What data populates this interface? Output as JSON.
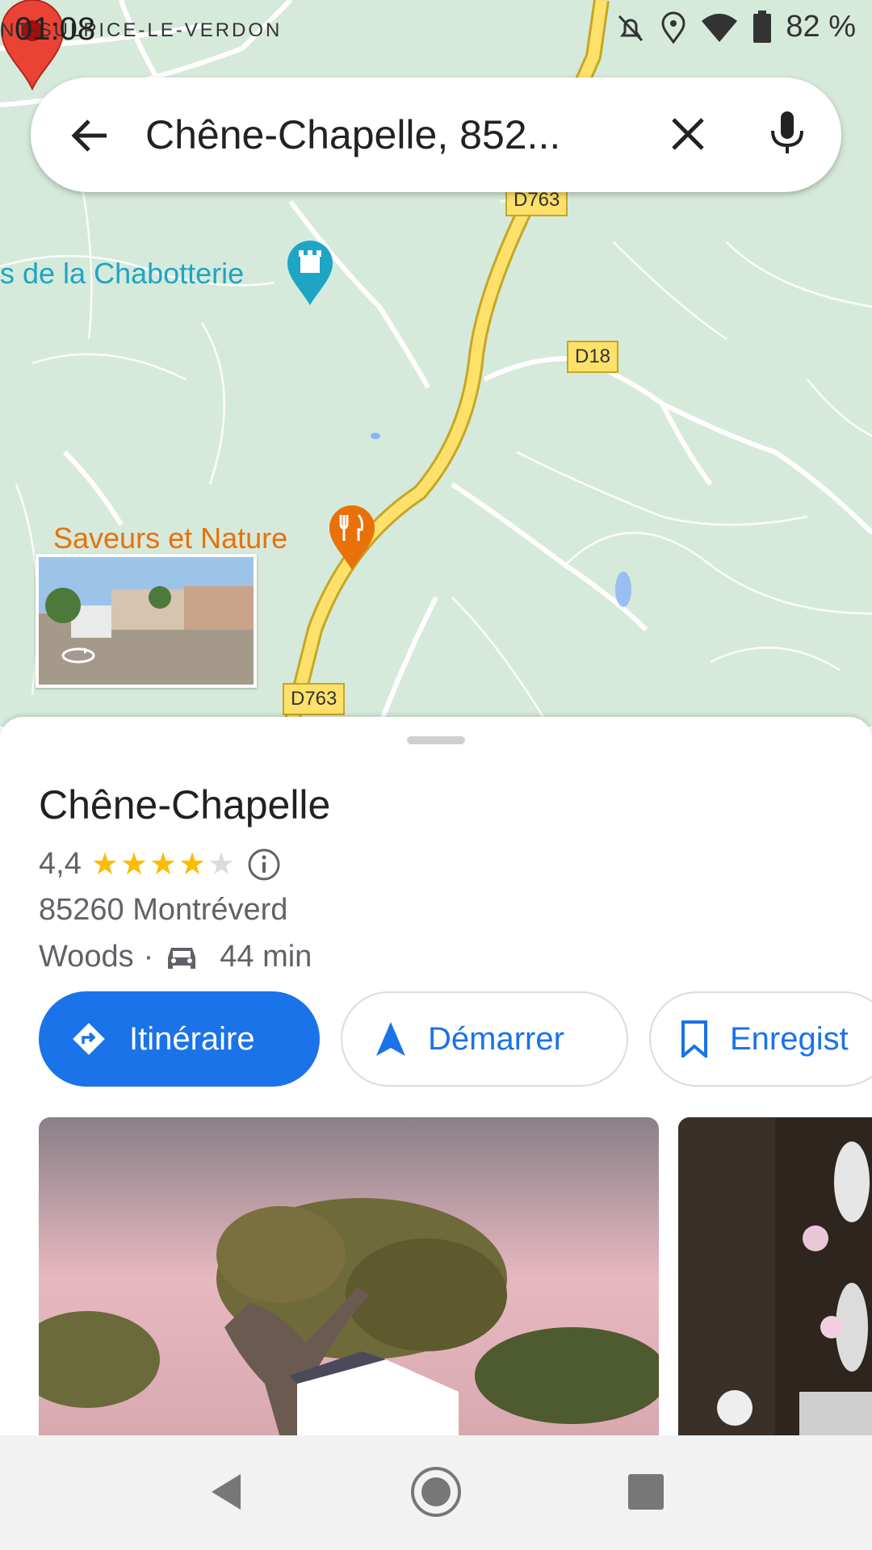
{
  "status_bar": {
    "time": "01:08",
    "battery": "82 %",
    "top_place": "NT-SULPICE-LE-VERDON"
  },
  "search": {
    "query": "Chêne-Chapelle, 852..."
  },
  "map": {
    "roads": [
      "D763",
      "D18",
      "D763"
    ],
    "poi": [
      {
        "label": "s de la Chabotterie",
        "icon": "castle-icon",
        "color": "#1ea5c4"
      },
      {
        "label": "Saveurs et Nature",
        "icon": "restaurant-icon",
        "color": "#e8710a"
      }
    ]
  },
  "place": {
    "title": "Chêne-Chapelle",
    "rating": "4,4",
    "address": "85260 Montréverd",
    "category": "Woods",
    "separator": "·",
    "drive_time": "44 min"
  },
  "actions": {
    "directions": "Itinéraire",
    "start": "Démarrer",
    "save": "Enregist"
  },
  "colors": {
    "accent": "#1a73e8",
    "map_bg": "#d6eadb",
    "pin": "#ea4335"
  }
}
